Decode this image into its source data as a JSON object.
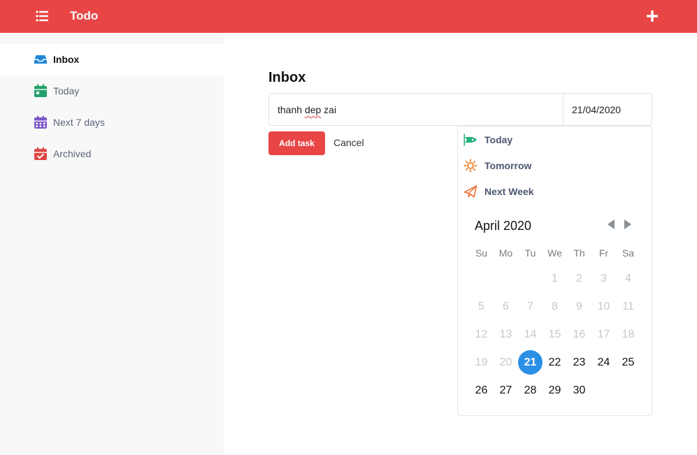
{
  "header": {
    "title": "Todo",
    "menu_icon": "list-icon",
    "add_icon": "plus-icon",
    "brand_color": "#e84646"
  },
  "sidebar": {
    "items": [
      {
        "label": "Inbox",
        "icon": "inbox-icon",
        "active": true
      },
      {
        "label": "Today",
        "icon": "calendar-today-icon"
      },
      {
        "label": "Next 7 days",
        "icon": "calendar-week-icon"
      },
      {
        "label": "Archived",
        "icon": "calendar-check-icon"
      }
    ]
  },
  "main": {
    "title": "Inbox",
    "task_input_value_a": "thanh ",
    "task_input_value_b": "dep",
    "task_input_value_c": " zai",
    "date_value": "21/04/2020",
    "add_button": "Add task",
    "cancel_button": "Cancel"
  },
  "picker": {
    "quick_options": [
      {
        "label": "Today",
        "icon": "rocket-icon"
      },
      {
        "label": "Tomorrow",
        "icon": "sun-icon"
      },
      {
        "label": "Next Week",
        "icon": "paper-plane-icon"
      }
    ],
    "month": "April 2020",
    "weekdays": [
      "Su",
      "Mo",
      "Tu",
      "We",
      "Th",
      "Fr",
      "Sa"
    ],
    "days": [
      "1",
      "2",
      "3",
      "4",
      "5",
      "6",
      "7",
      "8",
      "9",
      "10",
      "11",
      "12",
      "13",
      "14",
      "15",
      "16",
      "17",
      "18",
      "19",
      "20",
      "21",
      "22",
      "23",
      "24",
      "25",
      "26",
      "27",
      "28",
      "29",
      "30"
    ],
    "selected_day": "21",
    "selected_color": "#2b8fe6"
  }
}
